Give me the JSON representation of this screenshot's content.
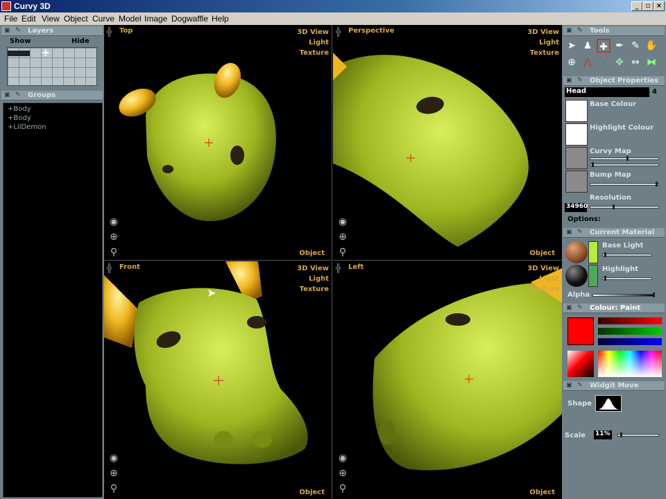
{
  "app": {
    "title": "Curvy 3D"
  },
  "menu": [
    "File",
    "Edit",
    "View",
    "Object",
    "Curve",
    "Model",
    "Image",
    "Dogwaffle",
    "Help"
  ],
  "layers": {
    "title": "Layers",
    "show": "Show",
    "hide": "Hide"
  },
  "groups": {
    "title": "Groups",
    "items": [
      "+Body",
      "+Body",
      "+LilDemon"
    ]
  },
  "viewports": [
    {
      "name": "Top",
      "modes": [
        "3D View",
        "Light",
        "Texture"
      ],
      "footer": "Object"
    },
    {
      "name": "Perspective",
      "modes": [
        "3D View",
        "Light",
        "Texture"
      ],
      "footer": "Object"
    },
    {
      "name": "Front",
      "modes": [
        "3D View",
        "Light",
        "Texture"
      ],
      "footer": "Object"
    },
    {
      "name": "Left",
      "modes": [
        "3D View",
        "Light",
        "Texture"
      ],
      "footer": "Object"
    }
  ],
  "tools": {
    "title": "Tools"
  },
  "object_properties": {
    "title": "Object Properties",
    "name": "Head",
    "count": "4",
    "base_colour": "Base Colour",
    "highlight_colour": "Highlight Colour",
    "curvy_map": "Curvy Map",
    "bump_map": "Bump Map",
    "resolution_label": "Resolution",
    "resolution_value": "34960",
    "options": "Options:"
  },
  "current_material": {
    "title": "Current Material",
    "base_light": "Base Light",
    "highlight": "Highlight",
    "alpha": "Alpha"
  },
  "colour": {
    "title": "Colour: Paint",
    "current": "#ff0000"
  },
  "widgit": {
    "title": "Widgit Move",
    "shape": "Shape",
    "scale": "Scale",
    "scale_value": "11%"
  },
  "colors": {
    "panel": "#6e7f87",
    "viewport_label": "#d8a645",
    "model": "#a9c22a"
  }
}
